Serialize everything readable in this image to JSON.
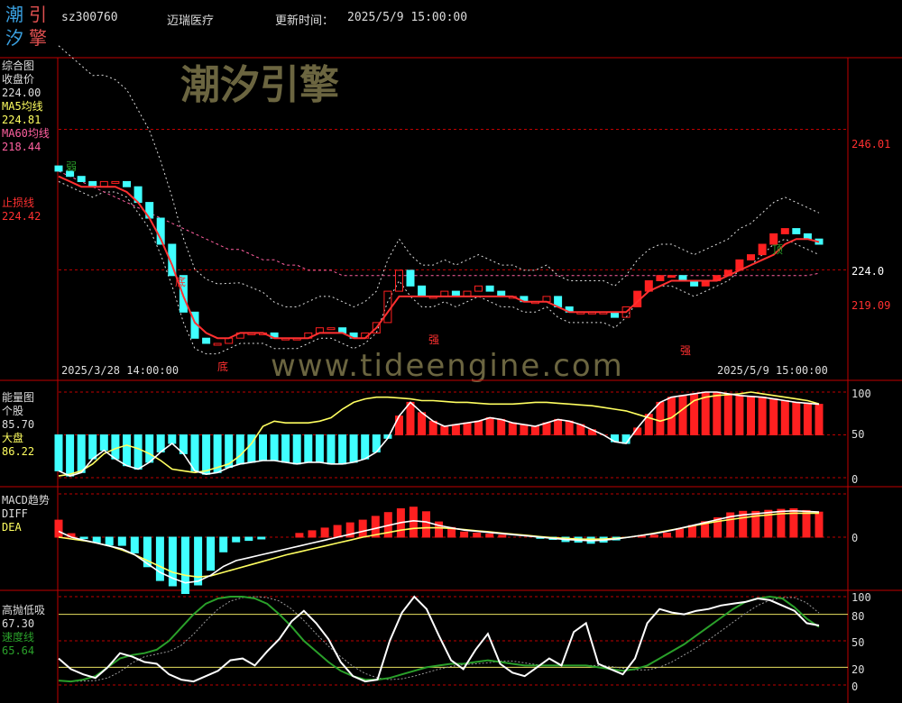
{
  "header": {
    "code": "sz300760",
    "name": "迈瑞医疗",
    "update_label": "更新时间：",
    "update_time": "2025/5/9 15:00:00",
    "logo_chars": [
      "潮",
      "引",
      "汐",
      "擎"
    ]
  },
  "watermark": {
    "title": "潮汐引擎",
    "url": "www.tideengine.com"
  },
  "colors": {
    "up": "#ff2020",
    "down": "#40ffff",
    "ma5": "#ffff60",
    "ma60": "#ff60a0",
    "axis": "#c00000",
    "stop": "#ff3030",
    "green": "#2aa02a"
  },
  "panel1": {
    "title": "综合图",
    "close_label": "收盘价",
    "close_value": "224.00",
    "ma5_label": "MA5均线",
    "ma5_value": "224.81",
    "ma60_label": "MA60均线",
    "ma60_value": "218.44",
    "stop_label": "止损线",
    "stop_value": "224.42",
    "axis": [
      "246.01",
      "224.0",
      "219.09"
    ],
    "start_date": "2025/3/28 14:00:00",
    "end_date": "2025/5/9 15:00:00",
    "markers": {
      "weak": "弱",
      "bottom1": "底",
      "bottom2": "底",
      "strong1": "强",
      "strong2": "强",
      "top": "顶"
    }
  },
  "panel2": {
    "title": "能量图",
    "stock_label": "个股",
    "stock_value": "85.70",
    "market_label": "大盘",
    "market_value": "86.22",
    "axis": [
      "100",
      "50",
      "0"
    ]
  },
  "panel3": {
    "title": "MACD趋势",
    "diff_label": "DIFF",
    "dea_label": "DEA",
    "axis": [
      "0"
    ]
  },
  "panel4": {
    "title": "高抛低吸",
    "value": "67.30",
    "speed_label": "速度线",
    "speed_value": "65.64",
    "axis": [
      "100",
      "80",
      "50",
      "20",
      "0"
    ]
  },
  "chart_data": [
    {
      "type": "candlestick",
      "x": [
        "2025/3/28 14:00:00",
        "2025/5/9 15:00:00"
      ],
      "ylim": [
        200,
        258
      ],
      "series": [
        {
          "name": "收盘价",
          "values": [
            238,
            237,
            236,
            235,
            236,
            236,
            235,
            232,
            229,
            224,
            218,
            211,
            206,
            205,
            205,
            206,
            207,
            207,
            207,
            206,
            206,
            206,
            207,
            208,
            208,
            207,
            206,
            207,
            209,
            215,
            219,
            216,
            214,
            214,
            215,
            214,
            215,
            216,
            215,
            214,
            214,
            213,
            213,
            214,
            212,
            211,
            211,
            211,
            211,
            210,
            212,
            215,
            217,
            218,
            218,
            217,
            216,
            217,
            218,
            219,
            221,
            222,
            224,
            226,
            227,
            226,
            225,
            224
          ]
        },
        {
          "name": "MA5均线",
          "values": [
            239,
            238,
            237,
            236,
            236,
            236,
            235,
            233,
            230,
            226,
            221,
            215,
            210,
            207,
            206,
            206,
            206,
            207,
            207,
            207,
            206,
            206,
            207,
            207,
            208,
            208,
            207,
            207,
            208,
            211,
            214,
            216,
            216,
            215,
            215,
            215,
            215,
            215,
            215,
            215,
            214,
            214,
            213,
            213,
            213,
            212,
            212,
            211,
            211,
            211,
            211,
            212,
            214,
            216,
            217,
            217,
            217,
            217,
            217,
            218,
            219,
            220,
            222,
            223,
            225,
            226,
            225,
            224.81
          ]
        },
        {
          "name": "MA60均线",
          "values": [
            238,
            237,
            236,
            235,
            234,
            233,
            232,
            231,
            230,
            229,
            228,
            227,
            226,
            225,
            224,
            223,
            223,
            222,
            221,
            221,
            220,
            220,
            219,
            219,
            219,
            218,
            218,
            218,
            218,
            218,
            218,
            218,
            218,
            218,
            218,
            218,
            218,
            218,
            218,
            218,
            218,
            218,
            218,
            218,
            218,
            218,
            218,
            218,
            218,
            218,
            218,
            218,
            218,
            218,
            218,
            218,
            218,
            218,
            218,
            218,
            218,
            218,
            218,
            218,
            218,
            218,
            218,
            218.44
          ]
        },
        {
          "name": "止损线",
          "values": [
            237,
            236,
            235,
            235,
            235,
            235,
            234,
            232,
            229,
            225,
            220,
            214,
            209,
            207,
            206,
            206,
            207,
            207,
            207,
            206,
            206,
            206,
            206,
            207,
            207,
            207,
            206,
            206,
            208,
            211,
            214,
            214,
            214,
            214,
            214,
            214,
            214,
            214,
            214,
            214,
            214,
            213,
            213,
            213,
            212,
            211,
            211,
            211,
            211,
            211,
            211,
            213,
            215,
            216,
            217,
            217,
            217,
            217,
            217,
            218,
            219,
            220,
            221,
            222,
            224,
            225,
            225,
            224.42
          ]
        }
      ]
    },
    {
      "type": "line",
      "ylim": [
        0,
        100
      ],
      "series": [
        {
          "name": "个股",
          "values": [
            8,
            2,
            6,
            22,
            32,
            22,
            14,
            10,
            18,
            30,
            40,
            28,
            8,
            4,
            6,
            12,
            16,
            18,
            20,
            20,
            18,
            16,
            18,
            18,
            16,
            16,
            18,
            22,
            30,
            46,
            72,
            88,
            76,
            66,
            60,
            62,
            64,
            66,
            70,
            68,
            64,
            62,
            60,
            64,
            68,
            66,
            62,
            56,
            50,
            42,
            40,
            58,
            74,
            88,
            94,
            96,
            98,
            100,
            100,
            98,
            96,
            95,
            94,
            92,
            90,
            88,
            87,
            85.7
          ]
        },
        {
          "name": "大盘",
          "values": [
            2,
            4,
            8,
            16,
            28,
            34,
            38,
            34,
            28,
            20,
            10,
            8,
            6,
            8,
            12,
            16,
            26,
            40,
            60,
            66,
            64,
            64,
            64,
            66,
            70,
            80,
            88,
            92,
            94,
            94,
            93,
            92,
            90,
            90,
            89,
            88,
            88,
            87,
            86,
            86,
            86,
            87,
            88,
            88,
            87,
            86,
            85,
            84,
            82,
            80,
            78,
            74,
            70,
            66,
            70,
            80,
            90,
            94,
            96,
            97,
            98,
            100,
            98,
            96,
            94,
            92,
            90,
            86.22
          ]
        }
      ]
    },
    {
      "type": "line",
      "series": [
        {
          "name": "DIFF",
          "values": [
            1,
            0,
            -0.5,
            -1,
            -1.5,
            -2,
            -3,
            -4.5,
            -6,
            -7,
            -7.8,
            -7.5,
            -6.5,
            -5,
            -4,
            -3.5,
            -3,
            -2.5,
            -2,
            -1.5,
            -1,
            -0.5,
            0,
            0.5,
            1,
            1.5,
            2,
            2.5,
            2.8,
            2.6,
            2,
            1.6,
            1.2,
            1,
            0.8,
            0.6,
            0.4,
            0.2,
            0,
            -0.2,
            -0.4,
            -0.5,
            -0.6,
            -0.5,
            -0.3,
            0,
            0.3,
            0.6,
            1,
            1.5,
            2,
            2.5,
            3,
            3.5,
            3.8,
            4,
            4.2,
            4.4,
            4.5,
            4.4,
            4.3
          ]
        },
        {
          "name": "DEA",
          "values": [
            0,
            -0.3,
            -0.6,
            -1,
            -1.5,
            -2.2,
            -3,
            -4,
            -5,
            -6,
            -6.5,
            -6.8,
            -6.6,
            -6,
            -5.4,
            -4.8,
            -4.2,
            -3.6,
            -3,
            -2.5,
            -2,
            -1.5,
            -1,
            -0.5,
            0,
            0.4,
            0.8,
            1.2,
            1.5,
            1.6,
            1.6,
            1.5,
            1.3,
            1.1,
            0.9,
            0.7,
            0.5,
            0.3,
            0.1,
            -0.1,
            -0.2,
            -0.3,
            -0.35,
            -0.3,
            -0.2,
            0,
            0.3,
            0.7,
            1.1,
            1.5,
            1.9,
            2.3,
            2.7,
            3,
            3.3,
            3.6,
            3.8,
            4,
            4.1,
            4.1,
            4.1
          ]
        }
      ]
    },
    {
      "type": "line",
      "ylim": [
        0,
        100
      ],
      "series": [
        {
          "name": "高抛低吸",
          "values": [
            30,
            18,
            12,
            8,
            20,
            36,
            32,
            26,
            24,
            12,
            6,
            4,
            10,
            16,
            28,
            30,
            22,
            38,
            52,
            72,
            84,
            70,
            52,
            26,
            10,
            4,
            6,
            50,
            82,
            100,
            86,
            56,
            28,
            18,
            40,
            58,
            24,
            14,
            10,
            20,
            30,
            22,
            60,
            70,
            24,
            18,
            12,
            30,
            70,
            86,
            82,
            80,
            84,
            86,
            90,
            92,
            94,
            98,
            96,
            90,
            84,
            70,
            67.3
          ]
        },
        {
          "name": "速度线",
          "values": [
            5,
            4,
            6,
            10,
            20,
            30,
            34,
            36,
            40,
            50,
            65,
            80,
            92,
            98,
            100,
            100,
            98,
            92,
            80,
            66,
            50,
            38,
            26,
            16,
            10,
            6,
            6,
            8,
            12,
            16,
            20,
            22,
            24,
            24,
            26,
            28,
            26,
            24,
            22,
            22,
            22,
            22,
            22,
            22,
            20,
            18,
            16,
            18,
            22,
            30,
            38,
            46,
            56,
            66,
            76,
            86,
            94,
            98,
            100,
            98,
            88,
            75,
            65.64
          ]
        }
      ]
    }
  ]
}
